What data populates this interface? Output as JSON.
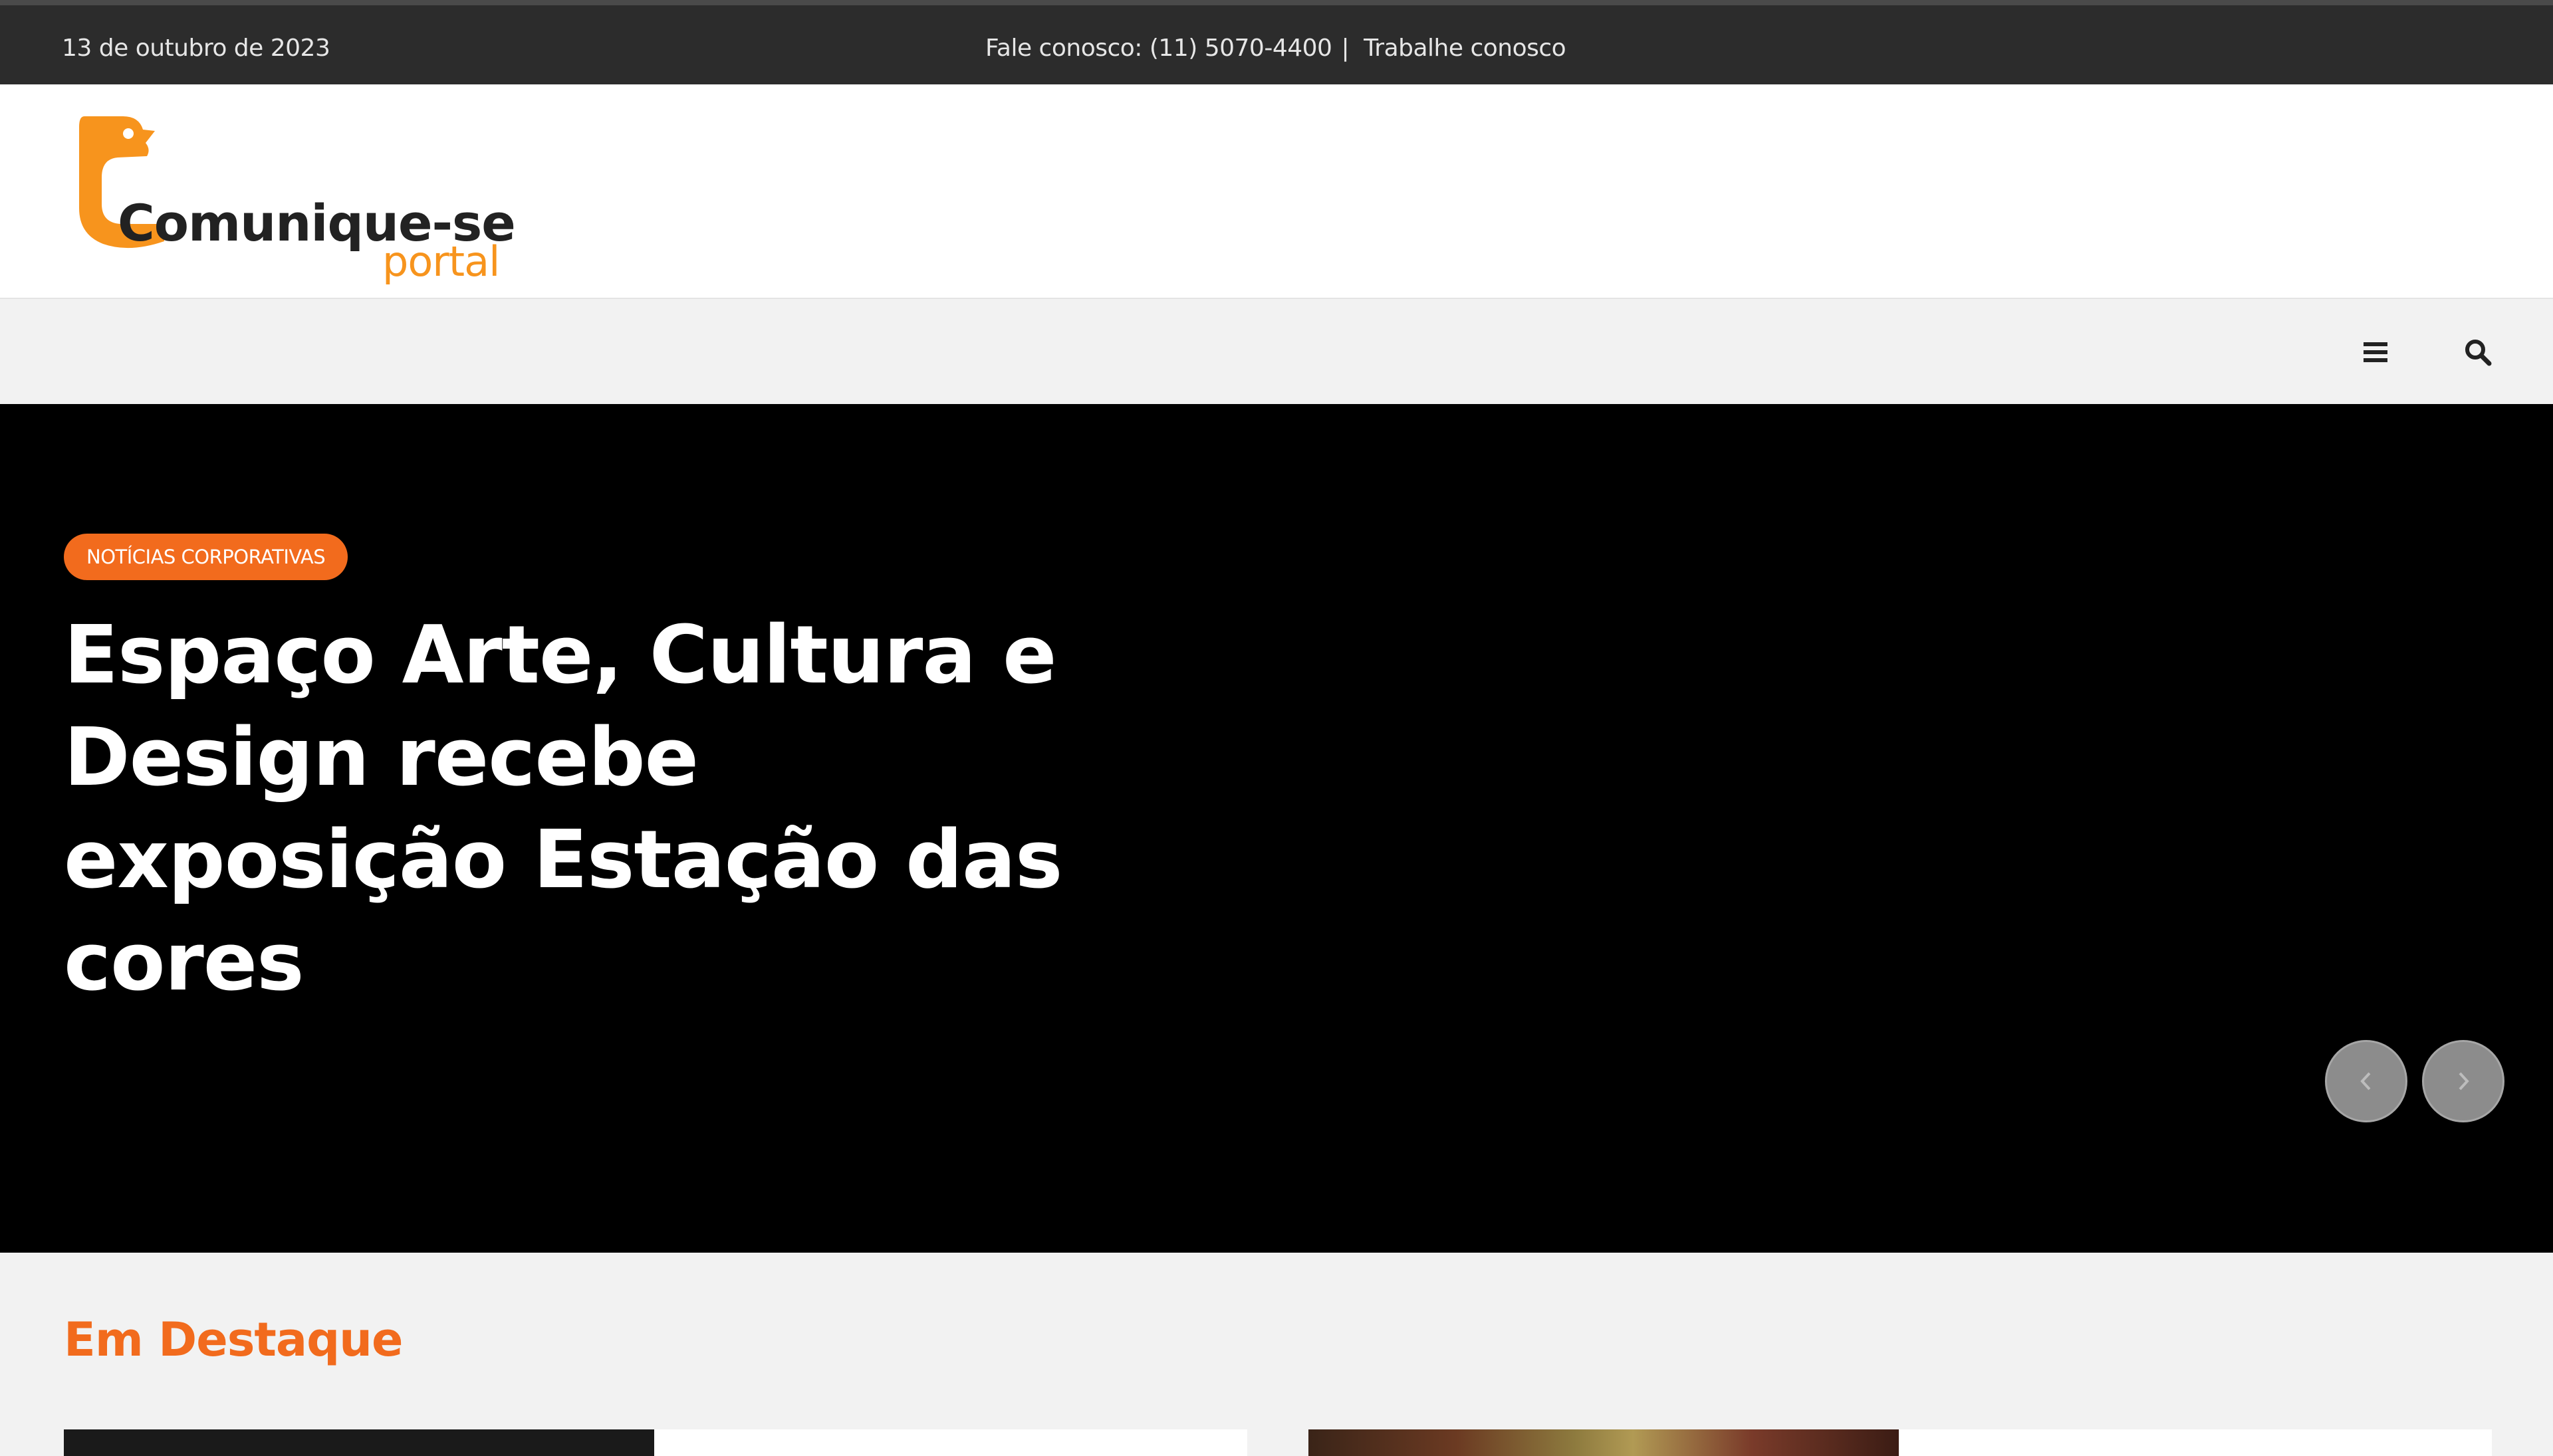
{
  "topbar": {
    "date": "13 de outubro de 2023",
    "contact": "Fale conosco: (11) 5070-4400",
    "separator": "|",
    "work_link": "Trabalhe conosco"
  },
  "header": {
    "logo_text": "Comunique-se",
    "logo_sub": "portal"
  },
  "nav": {
    "menu_icon": "hamburger-menu-icon",
    "search_icon": "search-icon"
  },
  "hero": {
    "category": "NOTÍCIAS CORPORATIVAS",
    "title": "Espaço Arte, Cultura e Design recebe exposição Estação das cores",
    "prev_icon": "chevron-left-icon",
    "next_icon": "chevron-right-icon"
  },
  "featured": {
    "title": "Em Destaque"
  },
  "colors": {
    "accent": "#f26b1d",
    "logo_orange": "#f7941d",
    "topbar": "#2c2c2c",
    "hero_bg": "#000000"
  }
}
